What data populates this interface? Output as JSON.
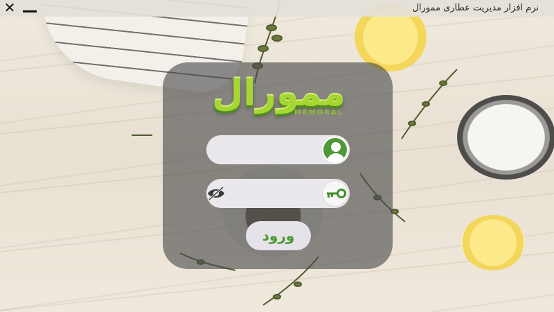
{
  "window": {
    "title": "نرم افزار مدیریت عطاری ممورال",
    "close_icon": "✕",
    "minimize_icon": "minimize-icon"
  },
  "logo": {
    "text_fa": "ممورال",
    "text_en": "MEMORAL",
    "colors": {
      "primary": "#a6d632",
      "dark": "#4e8f16"
    }
  },
  "login": {
    "username": {
      "value": "",
      "placeholder": "",
      "icon": "user-icon"
    },
    "password": {
      "value": "",
      "placeholder": "",
      "icon": "key-icon",
      "toggle_icon": "eye-slash-icon"
    },
    "submit_label": "ورود"
  }
}
